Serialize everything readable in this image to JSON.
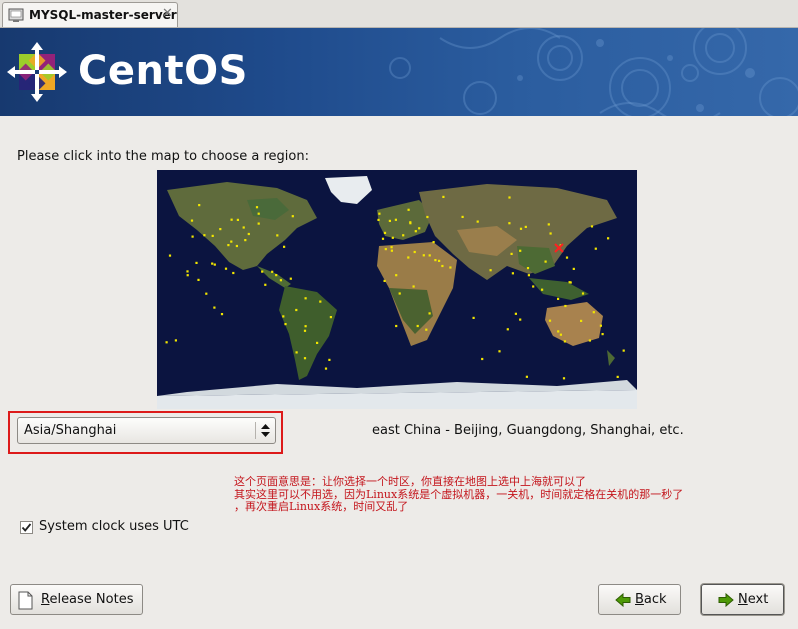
{
  "tab": {
    "title": "MYSQL-master-server",
    "close_glyph": "✕"
  },
  "banner": {
    "brand": "CentOS"
  },
  "prompt": "Please click into the map to choose a region:",
  "timezone": {
    "selected": "Asia/Shanghai",
    "description": "east China - Beijing, Guangdong, Shanghai, etc."
  },
  "annotation": {
    "line1": "这个页面意思是：让你选择一个时区，你直接在地图上选中上海就可以了",
    "line2": "其实这里可以不用选，因为Linux系统是个虚拟机器，一关机，时间就定格在关机的那一秒了",
    "line3": "，再次重启Linux系统，时间又乱了"
  },
  "utc": {
    "label": "System clock uses UTC",
    "checked": true
  },
  "buttons": {
    "release_notes": {
      "label_first": "R",
      "label_rest": "elease Notes"
    },
    "back": {
      "label_first": "B",
      "label_rest": "ack"
    },
    "next": {
      "label_first": "N",
      "label_rest": "ext"
    }
  },
  "colors": {
    "annotation": "#c4151c",
    "highlight_box": "#dd1a1a",
    "banner": "#1f4b8c",
    "map_ocean": "#0b1440",
    "city_dot": "#f2e600",
    "selected_city": "#ff2020"
  },
  "icons": {
    "tab": "terminal-icon",
    "logo": "centos-logo-icon",
    "release": "document-icon",
    "back": "arrow-left-icon",
    "next": "arrow-right-icon",
    "dropdown": "spinner-arrows-icon"
  }
}
